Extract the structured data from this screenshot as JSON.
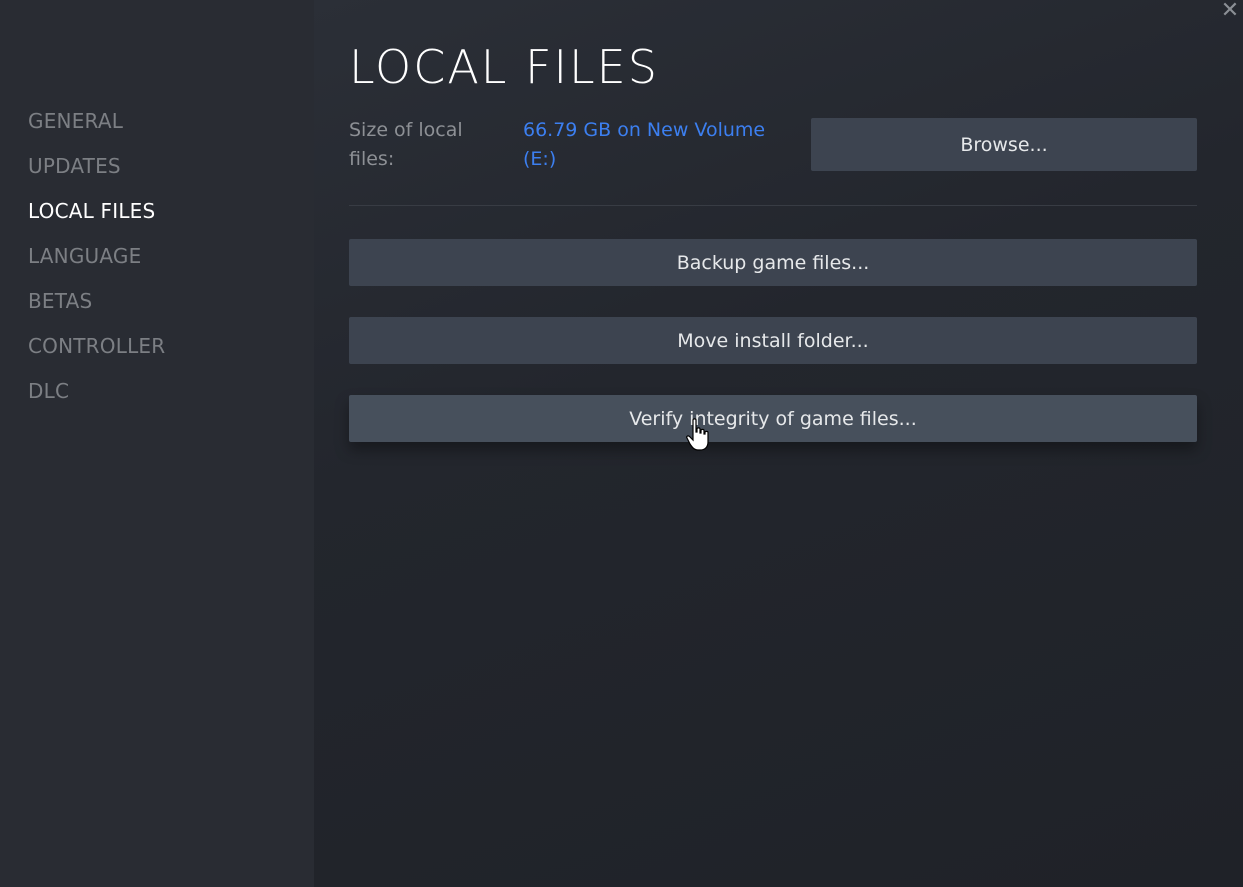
{
  "sidebar": {
    "items": [
      {
        "label": "GENERAL",
        "active": false
      },
      {
        "label": "UPDATES",
        "active": false
      },
      {
        "label": "LOCAL FILES",
        "active": true
      },
      {
        "label": "LANGUAGE",
        "active": false
      },
      {
        "label": "BETAS",
        "active": false
      },
      {
        "label": "CONTROLLER",
        "active": false
      },
      {
        "label": "DLC",
        "active": false
      }
    ]
  },
  "main": {
    "title": "LOCAL FILES",
    "size_label": "Size of local files:",
    "size_value": "66.79 GB on New Volume (E:)",
    "browse_label": "Browse...",
    "backup_label": "Backup game files...",
    "move_label": "Move install folder...",
    "verify_label": "Verify integrity of game files..."
  },
  "window": {
    "close_icon": "close-icon"
  },
  "colors": {
    "accent_link": "#3c7ff0",
    "button_bg": "#3d4450",
    "sidebar_bg": "#292c33"
  }
}
